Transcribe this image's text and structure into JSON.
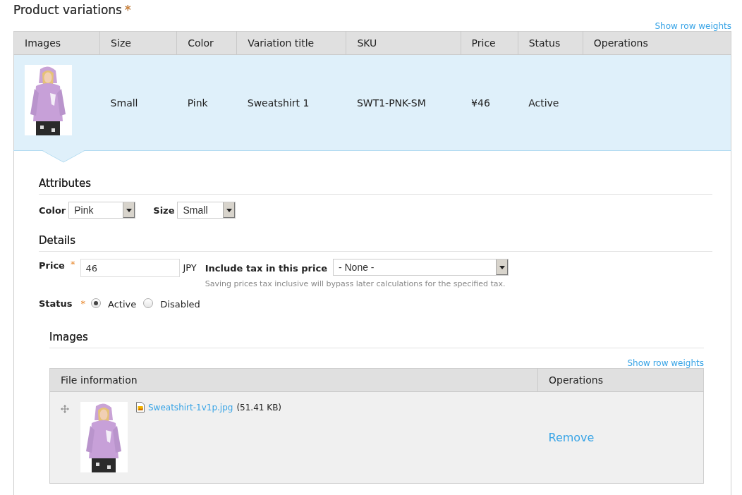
{
  "heading": {
    "title": "Product variations",
    "required_mark": "*"
  },
  "show_row_weights": "Show row weights",
  "variations_table": {
    "columns": [
      "Images",
      "Size",
      "Color",
      "Variation title",
      "SKU",
      "Price",
      "Status",
      "Operations"
    ],
    "rows": [
      {
        "size": "Small",
        "color_name": "Pink",
        "variation_title": "Sweatshirt 1",
        "sku": "SWT1-PNK-SM",
        "price": "¥46",
        "status": "Active",
        "selected": true
      }
    ]
  },
  "attributes": {
    "heading": "Attributes",
    "fields": [
      {
        "label": "Color",
        "value": "Pink"
      },
      {
        "label": "Size",
        "value": "Small"
      }
    ]
  },
  "details": {
    "heading": "Details",
    "price": {
      "label": "Price",
      "required_mark": "*",
      "value": "46",
      "currency": "JPY"
    },
    "tax": {
      "label": "Include tax in this price",
      "value": "- None -",
      "help": "Saving prices tax inclusive will bypass later calculations for the specified tax."
    },
    "status": {
      "label": "Status",
      "required_mark": "*",
      "options": [
        {
          "label": "Active",
          "selected": true
        },
        {
          "label": "Disabled",
          "selected": false
        }
      ]
    }
  },
  "images": {
    "heading": "Images",
    "show_row_weights": "Show row weights",
    "columns": [
      "File information",
      "Operations"
    ],
    "rows": [
      {
        "file_name": "Sweatshirt-1v1p.jpg",
        "file_size": "(51.41 KB)",
        "operation": "Remove"
      }
    ]
  }
}
